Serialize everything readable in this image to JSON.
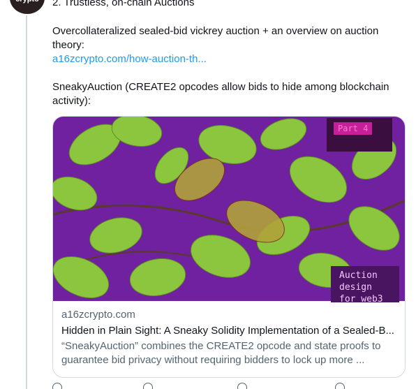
{
  "avatar": {
    "label": "crypto"
  },
  "tweet": {
    "heading": "2. Trustless, on-chain Auctions",
    "paragraph1": "Overcollateralized sealed-bid vickrey auction + an overview on auction theory:",
    "link": "a16zcrypto.com/how-auction-th...",
    "paragraph2": "SneakyAuction (CREATE2 opcodes allow bids to hide among blockchain activity):"
  },
  "card": {
    "tag_top": "Part 4",
    "tag_bottom_lines": [
      "Auction",
      "design",
      "for web3"
    ],
    "domain": "a16zcrypto.com",
    "title": "Hidden in Plain Sight: A Sneaky Solidity Implementation of a Sealed-B...",
    "description": "“SneakyAuction” combines the CREATE2 opcode and state proofs to guarantee bid privacy without requiring bidders to lock up more ..."
  },
  "colors": {
    "link": "#1d9bf0",
    "thread_line": "#cfd9de",
    "image_bg": "#6a1b9a",
    "leaf": "#8cc63f"
  },
  "icons": [
    "reply-icon",
    "retweet-icon",
    "like-icon",
    "share-icon"
  ]
}
